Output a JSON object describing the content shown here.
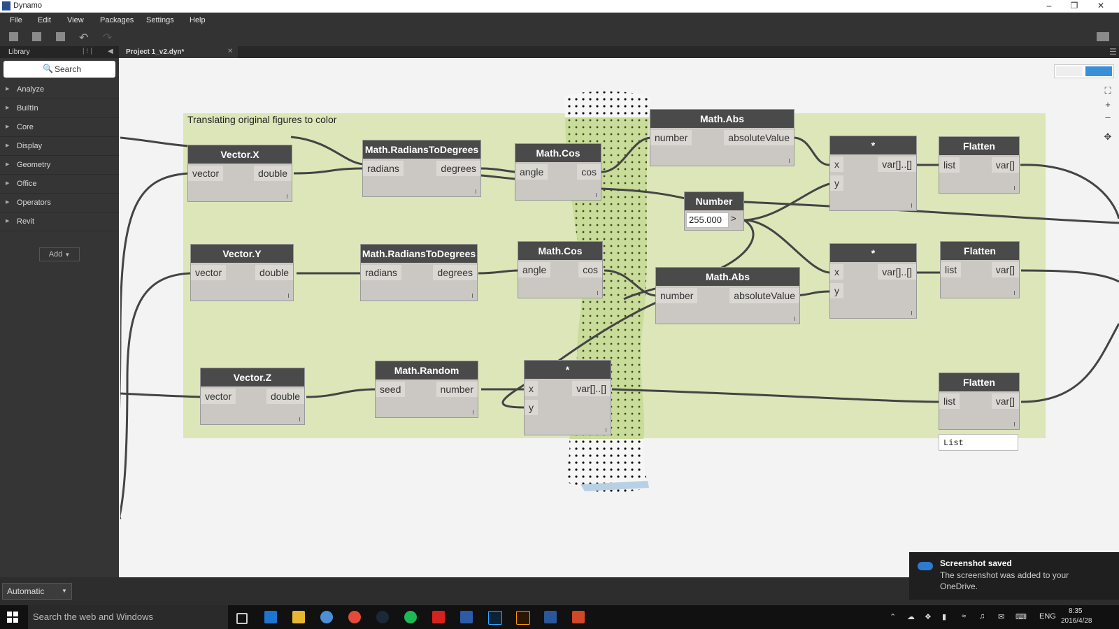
{
  "window": {
    "title": "Dynamo"
  },
  "menu": [
    "File",
    "Edit",
    "View",
    "Packages",
    "Settings",
    "Help"
  ],
  "library": {
    "header": "Library",
    "search_label": "Search",
    "categories": [
      "Analyze",
      "BuiltIn",
      "Core",
      "Display",
      "Geometry",
      "Office",
      "Operators",
      "Revit"
    ],
    "add_label": "Add"
  },
  "tab": {
    "label": "Project 1_v2.dyn*"
  },
  "group": {
    "title": "Translating original figures to color"
  },
  "nodes": {
    "vector_x": {
      "title": "Vector.X",
      "in": "vector",
      "out": "double"
    },
    "vector_y": {
      "title": "Vector.Y",
      "in": "vector",
      "out": "double"
    },
    "vector_z": {
      "title": "Vector.Z",
      "in": "vector",
      "out": "double"
    },
    "r2d_1": {
      "title": "Math.RadiansToDegrees",
      "in": "radians",
      "out": "degrees"
    },
    "r2d_2": {
      "title": "Math.RadiansToDegrees",
      "in": "radians",
      "out": "degrees"
    },
    "random": {
      "title": "Math.Random",
      "in": "seed",
      "out": "number"
    },
    "cos_1": {
      "title": "Math.Cos",
      "in": "angle",
      "out": "cos"
    },
    "cos_2": {
      "title": "Math.Cos",
      "in": "angle",
      "out": "cos"
    },
    "mult_3": {
      "title": "*",
      "in1": "x",
      "in2": "y",
      "out": "var[]..[]"
    },
    "abs_1": {
      "title": "Math.Abs",
      "in": "number",
      "out": "absoluteValue"
    },
    "abs_2": {
      "title": "Math.Abs",
      "in": "number",
      "out": "absoluteValue"
    },
    "number": {
      "title": "Number",
      "value": "255.000",
      "arrow": ">"
    },
    "mult_1": {
      "title": "*",
      "in1": "x",
      "in2": "y",
      "out": "var[]..[]"
    },
    "mult_2": {
      "title": "*",
      "in1": "x",
      "in2": "y",
      "out": "var[]..[]"
    },
    "flatten_1": {
      "title": "Flatten",
      "in": "list",
      "out": "var[]"
    },
    "flatten_2": {
      "title": "Flatten",
      "in": "list",
      "out": "var[]"
    },
    "flatten_3": {
      "title": "Flatten",
      "in": "list",
      "out": "var[]"
    },
    "list_preview": {
      "label": "List"
    }
  },
  "run": {
    "mode": "Automatic"
  },
  "taskbar": {
    "search_placeholder": "Search the web and Windows",
    "lang": "ENG",
    "time": "8:35",
    "date": "2016/4/28"
  },
  "toast": {
    "title": "Screenshot saved",
    "body": "The screenshot was added to your OneDrive."
  },
  "colors": {
    "group_fill": "#dde6b9",
    "node_header": "#4a4a4a",
    "node_body": "#cbc8c3"
  }
}
